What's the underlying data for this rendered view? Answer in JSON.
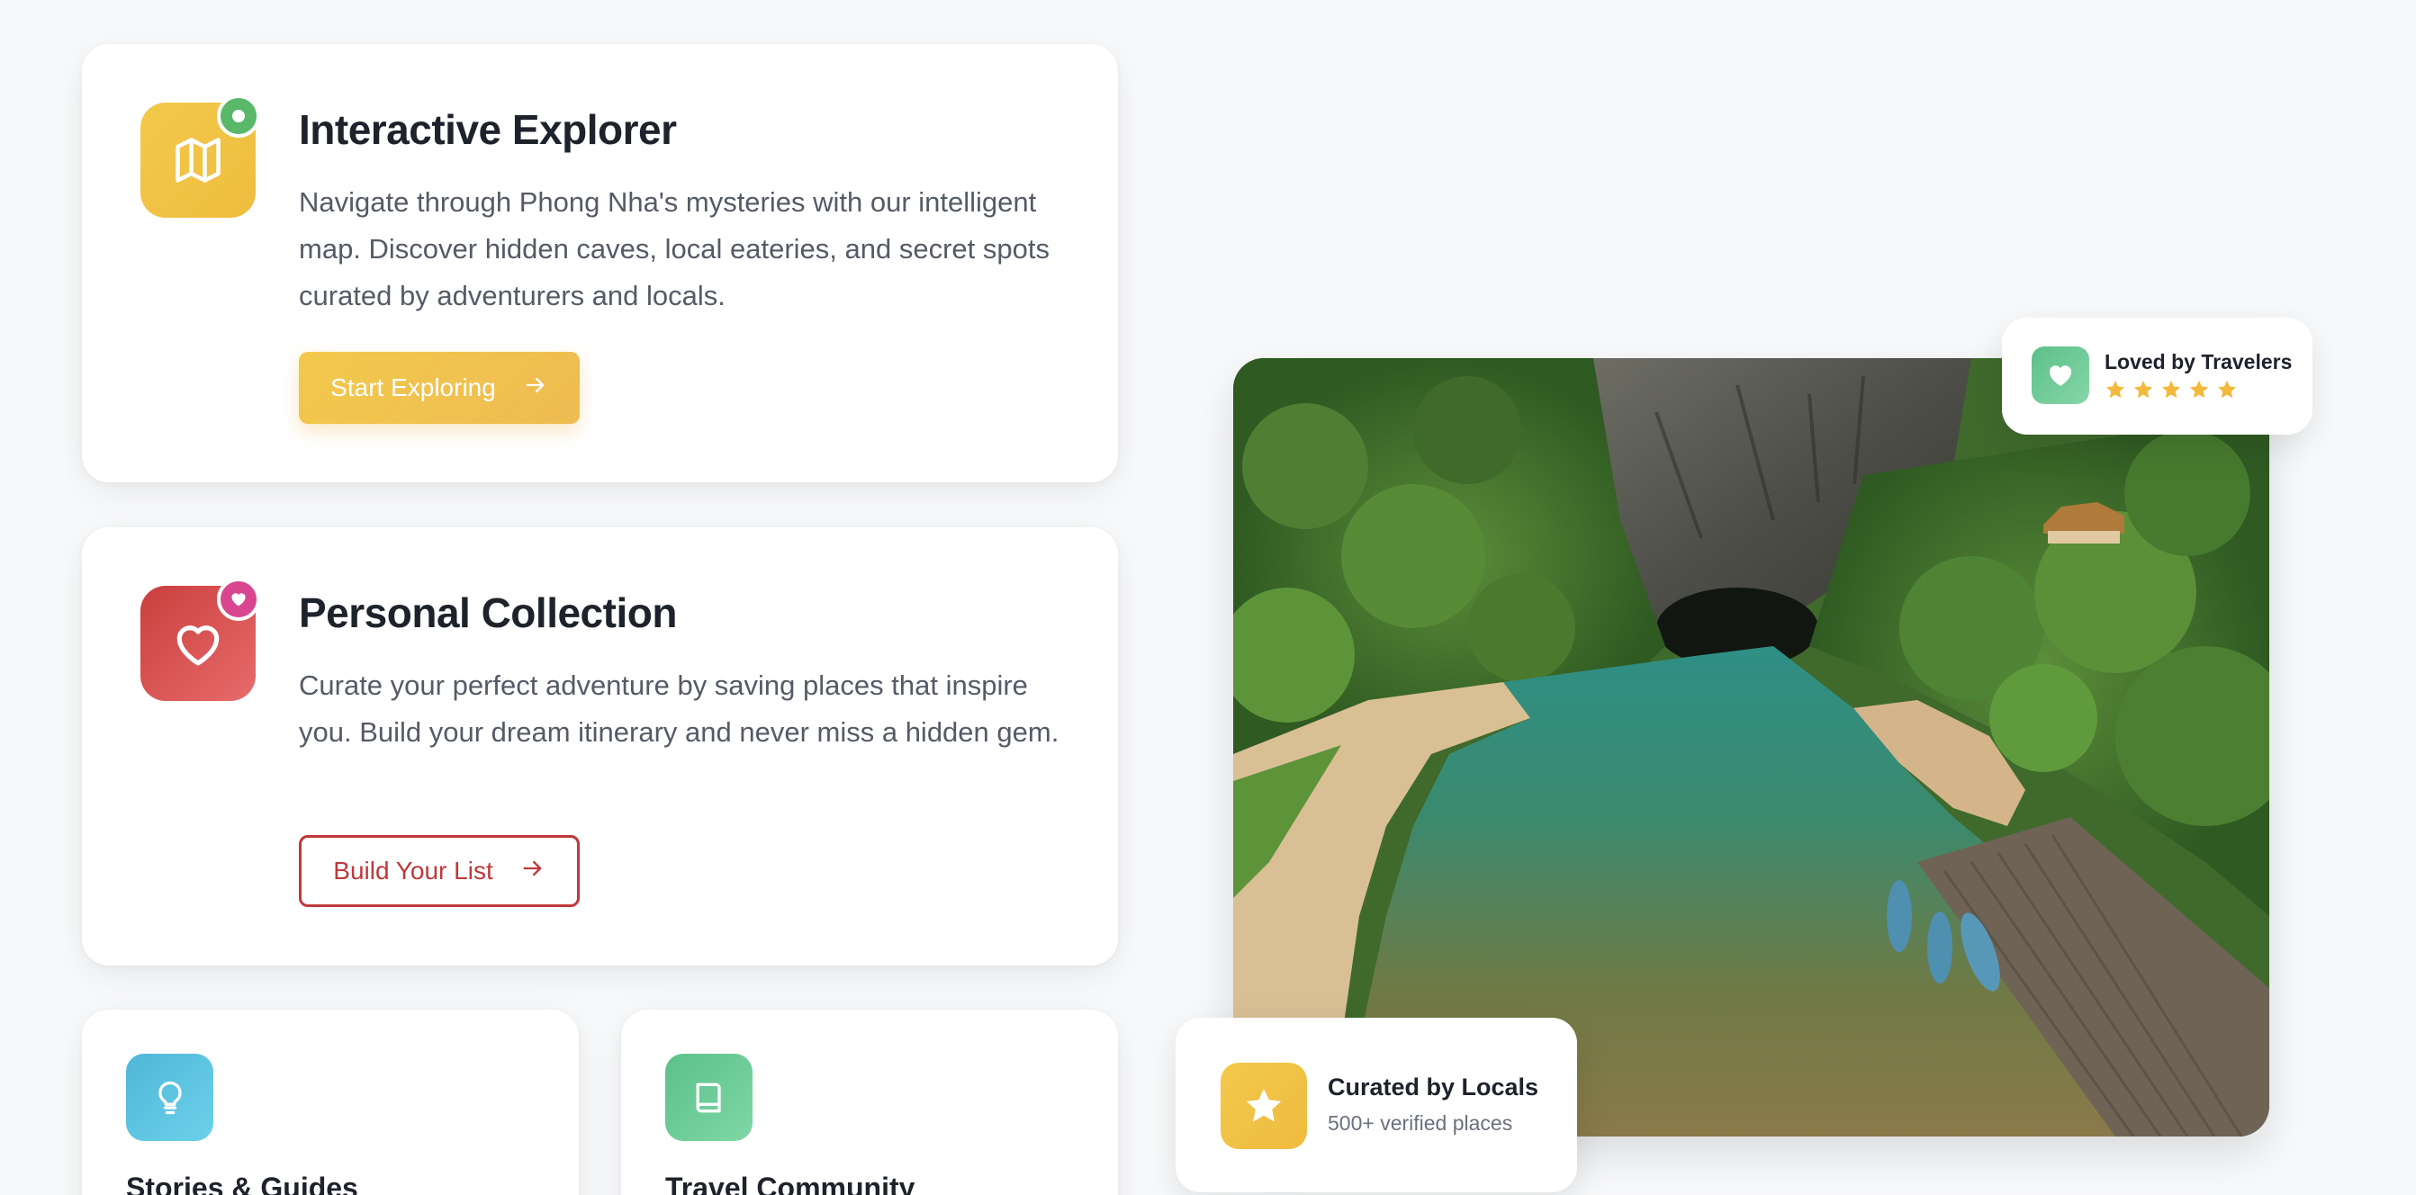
{
  "explorer": {
    "title": "Interactive Explorer",
    "description": "Navigate through Phong Nha's mysteries with our intelligent map. Discover hidden caves, local eateries, and secret spots curated by adventurers and locals.",
    "button_label": "Start Exploring",
    "icon": "map-icon",
    "badge_icon": "dot-icon"
  },
  "collection": {
    "title": "Personal Collection",
    "description": "Curate your perfect adventure by saving places that inspire you. Build your dream itinerary and never miss a hidden gem.",
    "button_label": "Build Your List",
    "icon": "heart-icon",
    "badge_icon": "heart-icon"
  },
  "small_cards": [
    {
      "title": "Stories & Guides",
      "icon": "lightbulb-icon",
      "color": "#5bc0de"
    },
    {
      "title": "Travel Community",
      "icon": "book-icon",
      "color": "#6fcf97"
    }
  ],
  "loved_card": {
    "title": "Loved by Travelers",
    "rating": 5,
    "icon": "heart-icon"
  },
  "curated_card": {
    "title": "Curated by Locals",
    "subtitle": "500+ verified places",
    "icon": "star-icon"
  },
  "colors": {
    "yellow": "#f2c94c",
    "red": "#c9403e",
    "green": "#59b86a",
    "pink": "#d9468f",
    "blue": "#5bc0de",
    "mint": "#6fcf97"
  }
}
